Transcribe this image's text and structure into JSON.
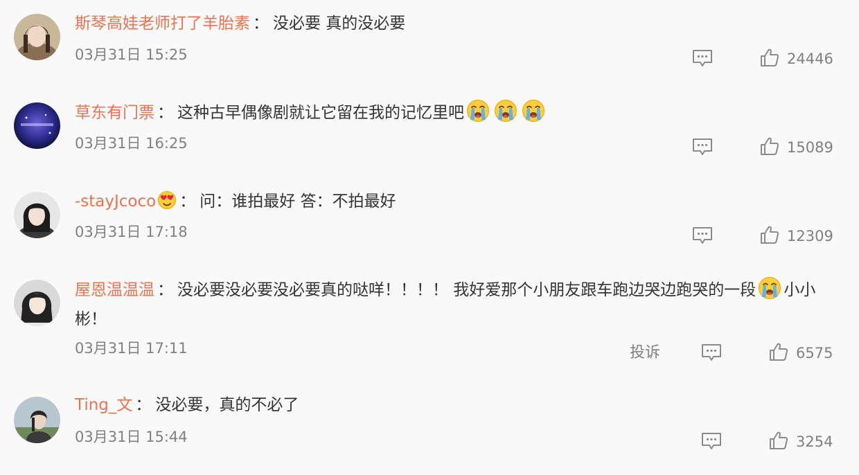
{
  "comments": [
    {
      "username": "斯琴高娃老师打了羊胎素",
      "sep": "：",
      "text": "没必要 真的没必要",
      "time": "03月31日 15:25",
      "likes": "24446"
    },
    {
      "username": "草东有门票",
      "sep": "：",
      "text": "这种古早偶像剧就让它留在我的记忆里吧",
      "emoji_names": [
        "crying-emoji",
        "crying-emoji",
        "crying-emoji"
      ],
      "time": "03月31日 16:25",
      "likes": "15089"
    },
    {
      "username": "-stayJcoco",
      "badge_icon": "heart-eyes-badge-icon",
      "sep": "：",
      "text": "问：谁拍最好 答：不拍最好",
      "time": "03月31日 17:18",
      "likes": "12309"
    },
    {
      "username": "屋恩温温温",
      "sep": "：",
      "text": "没必要没必要没必要真的哒咩！！！！ 我好爱那个小朋友跟车跑边哭边跑哭的一段",
      "emoji_names": [
        "crying-emoji"
      ],
      "text_tail": "小小",
      "text_line2": "彬！",
      "time": "03月31日 17:11",
      "report_label": "投诉",
      "likes": "6575"
    },
    {
      "username": "Ting_文",
      "sep": "：",
      "text": "没必要，真的不必了",
      "time": "03月31日 15:44",
      "likes": "3254"
    }
  ],
  "colors": {
    "background": "#f9f9f9",
    "username": "#eb7350",
    "text": "#333333",
    "meta": "#808080"
  },
  "icons": {
    "reply": "comment-bubble-icon",
    "like": "thumbs-up-icon"
  }
}
